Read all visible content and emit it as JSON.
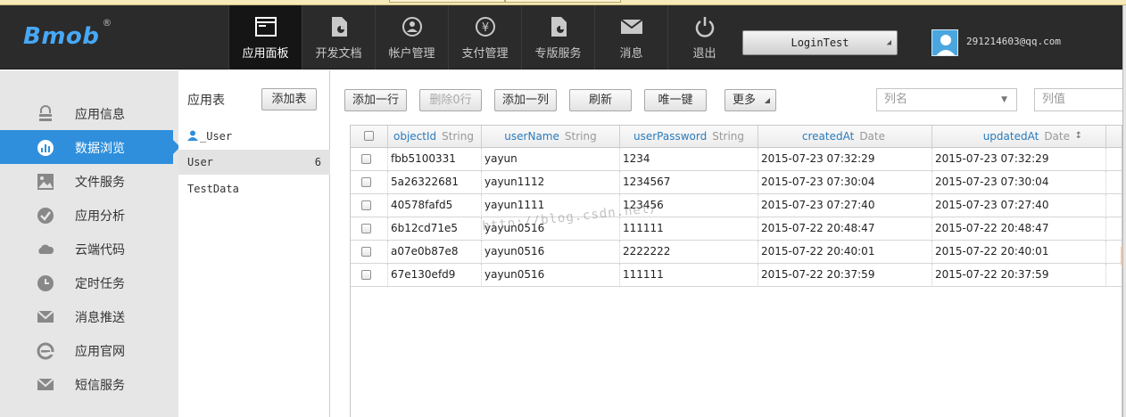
{
  "brand": {
    "name": "Bmob",
    "reg": "®"
  },
  "nav": [
    {
      "label": "应用面板",
      "icon": "dashboard-icon",
      "active": true
    },
    {
      "label": "开发文档",
      "icon": "document-icon"
    },
    {
      "label": "帐户管理",
      "icon": "account-icon"
    },
    {
      "label": "支付管理",
      "icon": "yen-icon"
    },
    {
      "label": "专版服务",
      "icon": "service-doc-icon"
    },
    {
      "label": "消息",
      "icon": "mail-icon"
    },
    {
      "label": "退出",
      "icon": "power-icon"
    }
  ],
  "app_select": {
    "value": "LoginTest"
  },
  "user": {
    "email": "291214603@qq.com"
  },
  "sidebar": {
    "items": [
      {
        "label": "应用信息",
        "icon": "lock-icon"
      },
      {
        "label": "数据浏览",
        "icon": "chart-icon",
        "active": true
      },
      {
        "label": "文件服务",
        "icon": "image-icon"
      },
      {
        "label": "应用分析",
        "icon": "check-icon"
      },
      {
        "label": "云端代码",
        "icon": "cloud-icon"
      },
      {
        "label": "定时任务",
        "icon": "clock-icon"
      },
      {
        "label": "消息推送",
        "icon": "message-icon"
      },
      {
        "label": "应用官网",
        "icon": "ie-icon"
      },
      {
        "label": "短信服务",
        "icon": "sms-icon"
      }
    ]
  },
  "tables_panel": {
    "title": "应用表",
    "add_button": "添加表",
    "items": [
      {
        "name": "_User",
        "count": "",
        "icon": "user-icon"
      },
      {
        "name": "User",
        "count": "6",
        "selected": true
      },
      {
        "name": "TestData",
        "count": ""
      }
    ]
  },
  "toolbar": {
    "add_row": "添加一行",
    "delete_rows": "删除0行",
    "add_column": "添加一列",
    "refresh": "刷新",
    "unique_key": "唯一键",
    "more": "更多",
    "column_name_placeholder": "列名",
    "column_value_placeholder": "列值"
  },
  "grid": {
    "columns": [
      {
        "name": "objectId",
        "type": "String"
      },
      {
        "name": "userName",
        "type": "String"
      },
      {
        "name": "userPassword",
        "type": "String"
      },
      {
        "name": "createdAt",
        "type": "Date"
      },
      {
        "name": "updatedAt",
        "type": "Date",
        "sort": "↕"
      }
    ],
    "rows": [
      [
        "fbb5100331",
        "yayun",
        "1234",
        "2015-07-23 07:32:29",
        "2015-07-23 07:32:29"
      ],
      [
        "5a26322681",
        "yayun1112",
        "1234567",
        "2015-07-23 07:30:04",
        "2015-07-23 07:30:04"
      ],
      [
        "40578fafd5",
        "yayun1111",
        "123456",
        "2015-07-23 07:27:40",
        "2015-07-23 07:27:40"
      ],
      [
        "6b12cd71e5",
        "yayun0516",
        "111111",
        "2015-07-22 20:48:47",
        "2015-07-22 20:48:47"
      ],
      [
        "a07e0b87e8",
        "yayun0516",
        "2222222",
        "2015-07-22 20:40:01",
        "2015-07-22 20:40:01"
      ],
      [
        "67e130efd9",
        "yayun0516",
        "111111",
        "2015-07-22 20:37:59",
        "2015-07-22 20:37:59"
      ]
    ]
  },
  "watermark": "http://blog.csdn.net/",
  "colors": {
    "accent": "#2f8fdc",
    "header": "#2b2b2b",
    "logo": "#47a8f5"
  }
}
